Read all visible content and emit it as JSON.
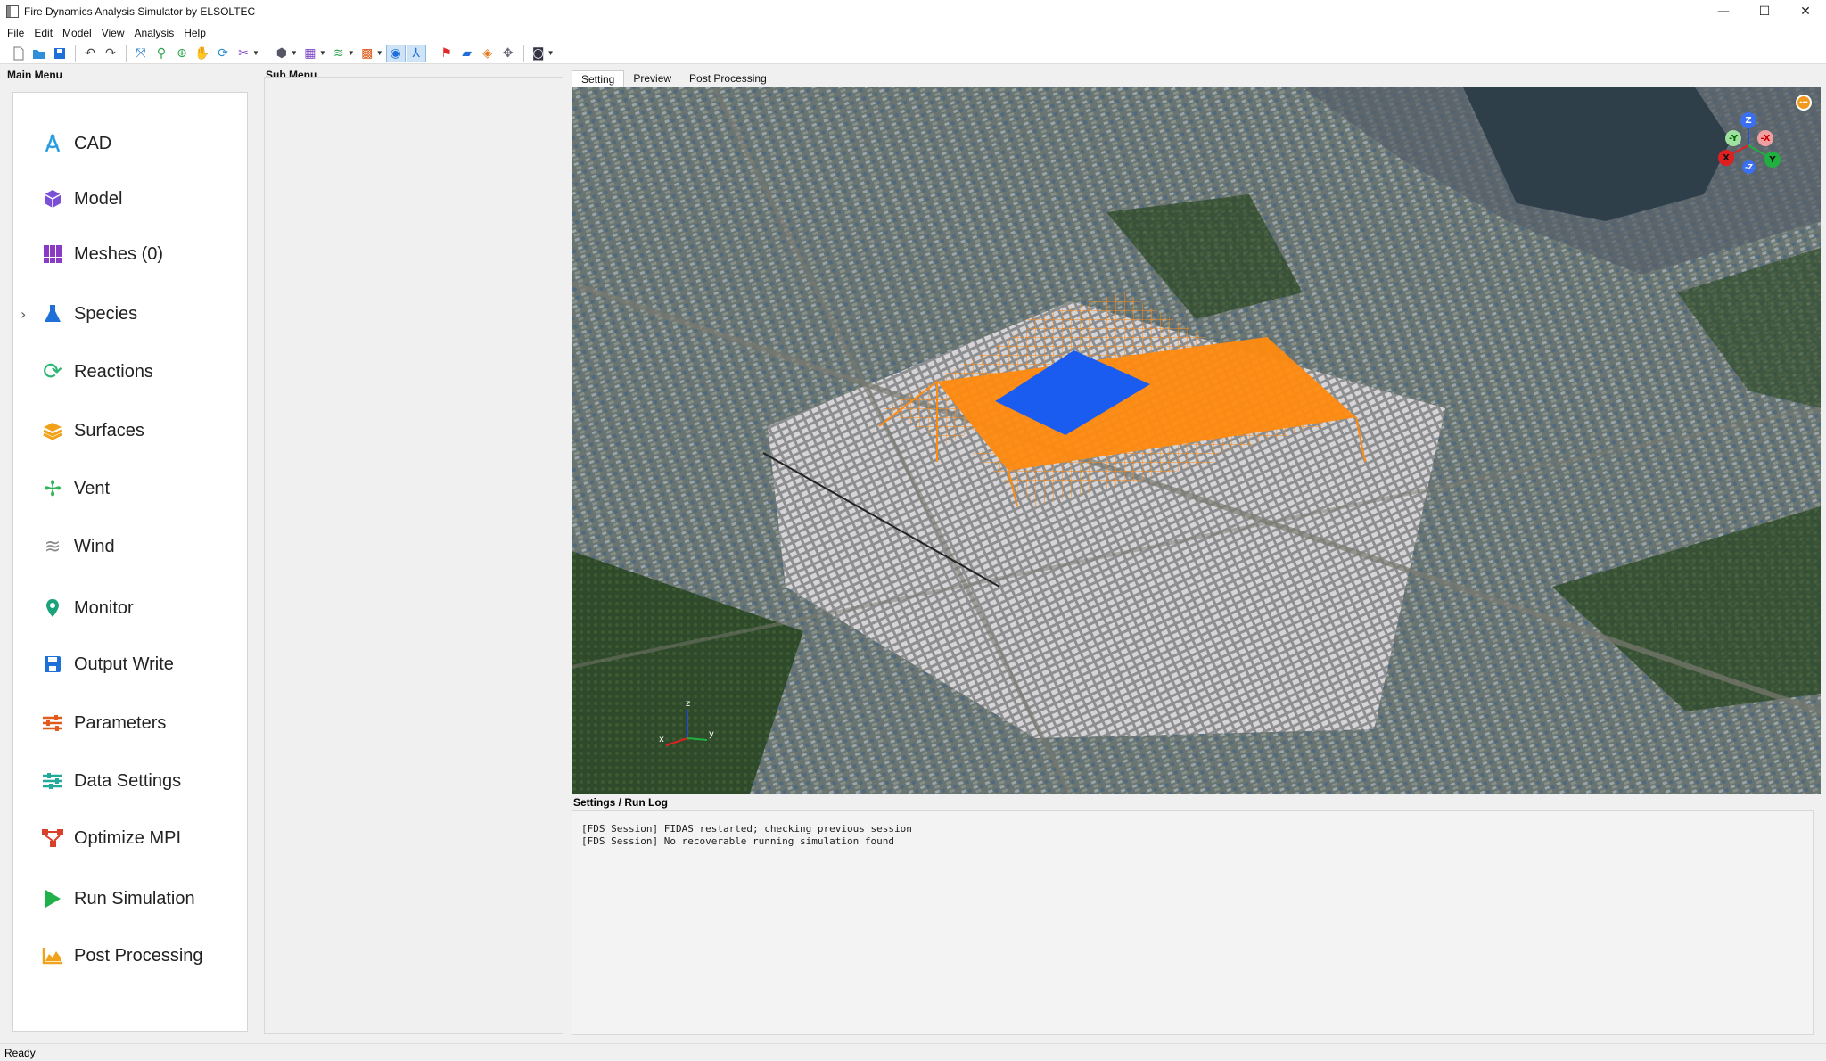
{
  "window": {
    "title": "Fire Dynamics Analysis Simulator by ELSOLTEC",
    "minimize": "—",
    "maximize": "☐",
    "close": "✕"
  },
  "menubar": [
    "File",
    "Edit",
    "Model",
    "View",
    "Analysis",
    "Help"
  ],
  "toolbar": {
    "icons": [
      "new-file-icon",
      "open-folder-icon",
      "save-icon",
      "undo-icon",
      "redo-icon",
      "fit-view-icon",
      "zoom-icon",
      "zoom-in-icon",
      "pan-hand-icon",
      "rotate-icon",
      "tools-icon",
      "cube-icon",
      "grid-icon",
      "wind-icon",
      "blocks-icon",
      "compass-icon",
      "axes-icon",
      "marker-icon",
      "ruler-icon",
      "box-icon",
      "move-icon",
      "camera-icon"
    ]
  },
  "panels": {
    "main_menu_title": "Main Menu",
    "sub_menu_title": "Sub Menu",
    "log_title": "Settings / Run Log"
  },
  "main_menu": [
    {
      "label": "CAD",
      "icon": "cad-compass-icon",
      "color": "#2a9de0"
    },
    {
      "label": "Model",
      "icon": "model-cube-icon",
      "color": "#7b4fd6"
    },
    {
      "label": "Meshes (0)",
      "icon": "meshes-grid-icon",
      "color": "#8a3bc4"
    },
    {
      "label": "Species",
      "icon": "species-flask-icon",
      "color": "#1f6fd8"
    },
    {
      "label": "Reactions",
      "icon": "reactions-cycle-icon",
      "color": "#2bb673"
    },
    {
      "label": "Surfaces",
      "icon": "surfaces-layers-icon",
      "color": "#f1a21a"
    },
    {
      "label": "Vent",
      "icon": "vent-fan-icon",
      "color": "#2fb457"
    },
    {
      "label": "Wind",
      "icon": "wind-icon",
      "color": "#8a8a8a"
    },
    {
      "label": "Monitor",
      "icon": "monitor-pin-icon",
      "color": "#1aa37a"
    },
    {
      "label": "Output Write",
      "icon": "output-save-icon",
      "color": "#1f6fd8"
    },
    {
      "label": "Parameters",
      "icon": "parameters-sliders-icon",
      "color": "#e25a1c"
    },
    {
      "label": "Data Settings",
      "icon": "data-settings-sliders-icon",
      "color": "#22a99a"
    },
    {
      "label": "Optimize MPI",
      "icon": "optimize-mpi-network-icon",
      "color": "#d8402a"
    },
    {
      "label": "Run Simulation",
      "icon": "run-play-icon",
      "color": "#21b04b"
    },
    {
      "label": "Post Processing",
      "icon": "post-processing-chart-icon",
      "color": "#f1a21a"
    }
  ],
  "tabs": [
    {
      "label": "Setting",
      "active": true
    },
    {
      "label": "Preview",
      "active": false
    },
    {
      "label": "Post Processing",
      "active": false
    }
  ],
  "viewport": {
    "gizmo": {
      "z": "Z",
      "neg_x": "-X",
      "neg_y": "-Y",
      "x": "X",
      "y": "Y",
      "neg_z": "-Z"
    },
    "mini_axes": {
      "z": "z",
      "x": "x",
      "y": "y"
    }
  },
  "log": [
    "[FDS Session] FIDAS restarted; checking previous session",
    "[FDS Session] No recoverable running simulation found"
  ],
  "status": "Ready"
}
